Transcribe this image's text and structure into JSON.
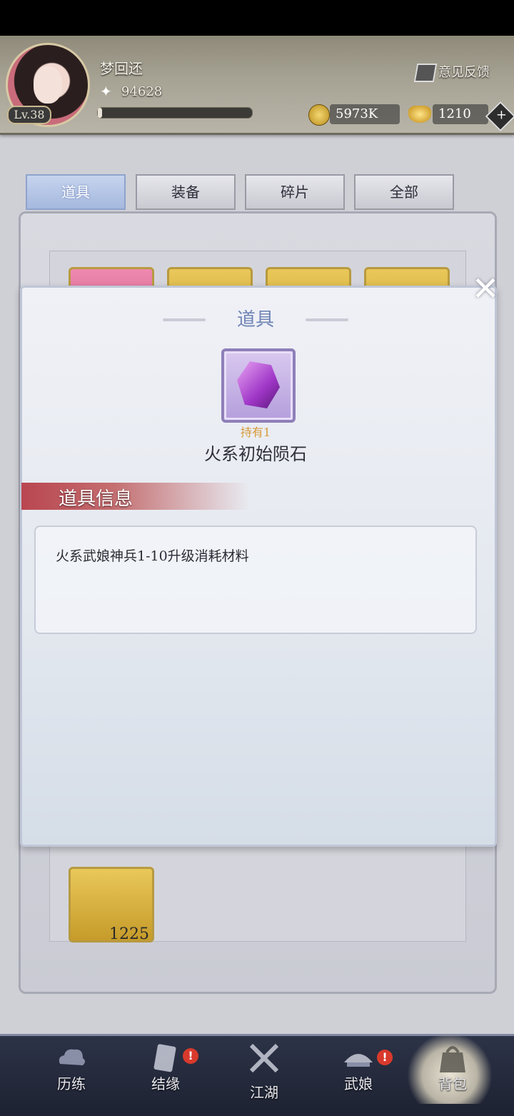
{
  "header": {
    "player_name": "梦回还",
    "level": "Lv.38",
    "power": "94628",
    "feedback_label": "意见反馈",
    "coins": "5973K",
    "ingots": "1210"
  },
  "tabs": [
    {
      "label": "道具",
      "active": true
    },
    {
      "label": "装备",
      "active": false
    },
    {
      "label": "碎片",
      "active": false
    },
    {
      "label": "全部",
      "active": false
    }
  ],
  "inventory": {
    "visible_count": "1225"
  },
  "dialog": {
    "title": "道具",
    "hold_label": "持有1",
    "item_name": "火系初始陨石",
    "info_title": "道具信息",
    "description": "火系武娘神兵1-10升级消耗材料"
  },
  "bottom_nav": [
    {
      "label": "历练",
      "icon": "cloud-icon",
      "badge": false
    },
    {
      "label": "结缘",
      "icon": "card-icon",
      "badge": true
    },
    {
      "label": "江湖",
      "icon": "crossed-swords-icon",
      "badge": false
    },
    {
      "label": "武娘",
      "icon": "hat-icon",
      "badge": true
    },
    {
      "label": "背包",
      "icon": "bag-icon",
      "badge": false,
      "active": true
    }
  ],
  "colors": {
    "tab_active": "#a5b8de",
    "dialog_title": "#6f84b5",
    "hold_text": "#d79a3a",
    "info_band": "#b94650",
    "badge": "#d83a2c"
  }
}
